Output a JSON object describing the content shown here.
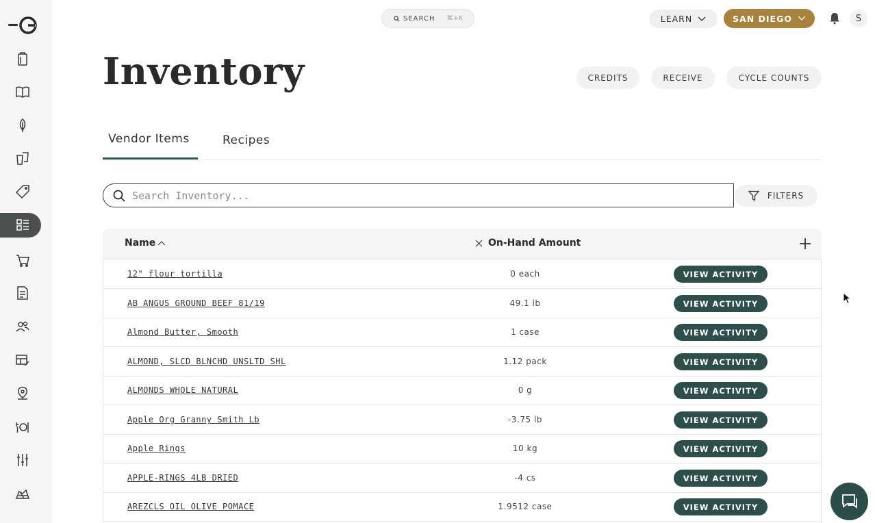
{
  "topbar": {
    "search_label": "SEARCH",
    "search_shortcut": "⌘+K",
    "learn_label": "LEARN",
    "location_label": "SAN DIEGO",
    "avatar_initial": "S"
  },
  "page": {
    "title": "Inventory",
    "actions": [
      "CREDITS",
      "RECEIVE",
      "CYCLE COUNTS"
    ]
  },
  "tabs": [
    {
      "label": "Vendor Items",
      "active": true
    },
    {
      "label": "Recipes",
      "active": false
    }
  ],
  "search": {
    "placeholder": "Search Inventory...",
    "value": "",
    "filters_label": "FILTERS"
  },
  "table": {
    "columns": {
      "name": "Name",
      "on_hand": "On-Hand Amount"
    },
    "action_label": "VIEW ACTIVITY",
    "rows": [
      {
        "name": "12\" flour tortilla",
        "amount": "0 each"
      },
      {
        "name": "AB ANGUS GROUND BEEF 81/19",
        "amount": "49.1 lb"
      },
      {
        "name": "Almond Butter, Smooth",
        "amount": "1 case"
      },
      {
        "name": "ALMOND, SLCD BLNCHD UNSLTD SHL",
        "amount": "1.12 pack"
      },
      {
        "name": "ALMONDS WHOLE NATURAL",
        "amount": "0 g"
      },
      {
        "name": "Apple Org Granny Smith Lb",
        "amount": "-3.75 lb"
      },
      {
        "name": "Apple Rings",
        "amount": "10 kg"
      },
      {
        "name": "APPLE-RINGS 4LB DRIED",
        "amount": "-4 cs"
      },
      {
        "name": "AREZCLS OIL OLIVE POMACE",
        "amount": "1.9512 case"
      }
    ]
  },
  "sidebar": {
    "items": [
      "clipboard-icon",
      "book-icon",
      "leaf-icon",
      "cups-icon",
      "tag-icon",
      "inventory-icon",
      "cart-icon",
      "document-icon",
      "people-icon",
      "table-edit-icon",
      "location-pin-icon",
      "dining-icon",
      "sliders-icon",
      "map-icon"
    ],
    "active_index": 5
  },
  "colors": {
    "accent_teal": "#2e4e4b",
    "location_gold": "#a8823f",
    "sidebar_bg": "#f4f5f4"
  }
}
